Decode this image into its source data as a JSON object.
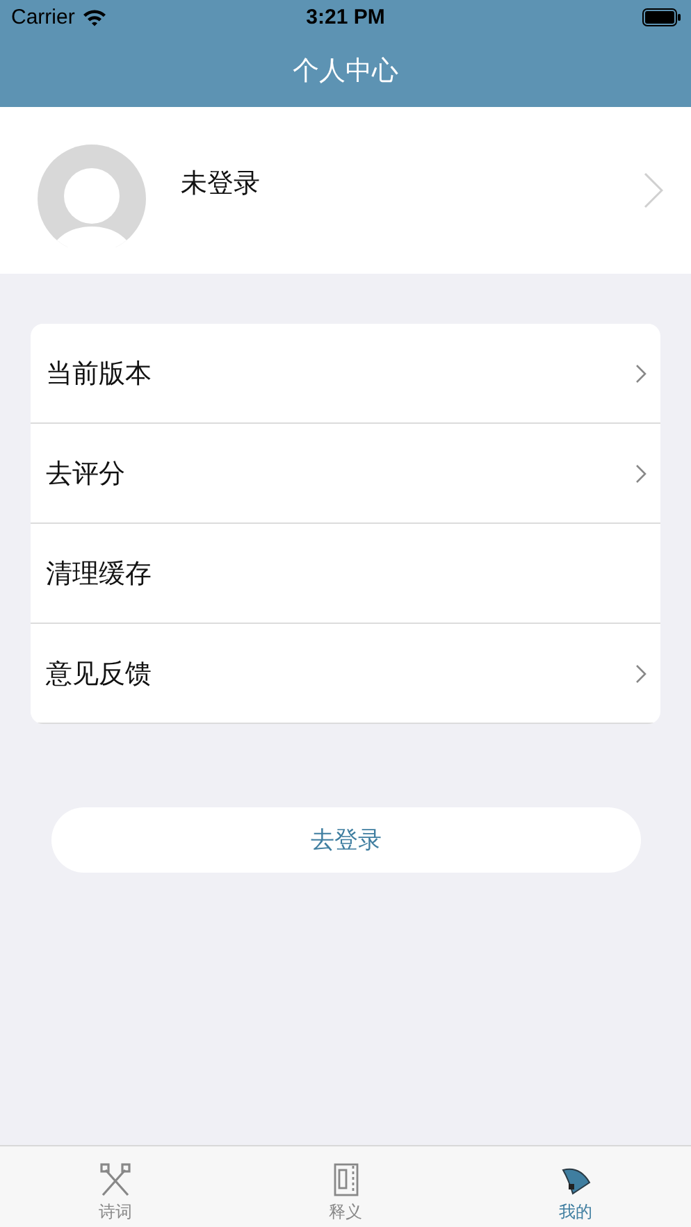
{
  "status_bar": {
    "carrier": "Carrier",
    "time": "3:21 PM"
  },
  "nav_bar": {
    "title": "个人中心"
  },
  "profile": {
    "name": "未登录"
  },
  "menu": [
    {
      "label": "当前版本",
      "chevron": true
    },
    {
      "label": "去评分",
      "chevron": true
    },
    {
      "label": "清理缓存",
      "chevron": false
    },
    {
      "label": "意见反馈",
      "chevron": true
    }
  ],
  "login_button": "去登录",
  "tabs": [
    {
      "label": "诗词",
      "kind": "brushes",
      "selected": false
    },
    {
      "label": "释义",
      "kind": "book",
      "selected": false
    },
    {
      "label": "我的",
      "kind": "fan",
      "selected": true
    }
  ]
}
